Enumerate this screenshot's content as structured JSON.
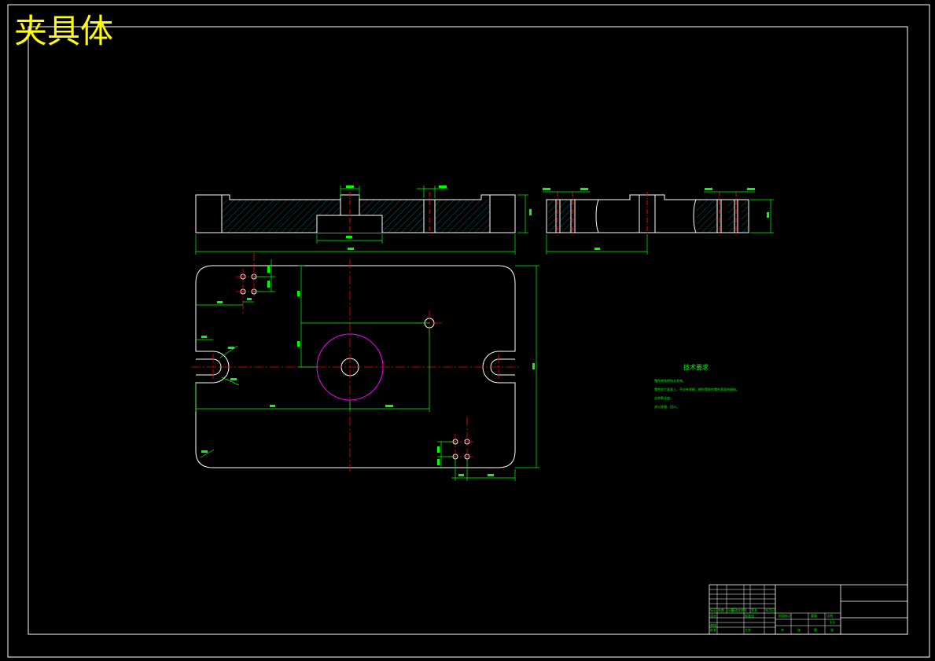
{
  "drawing_title": "夹具体",
  "technical_requirements": {
    "heading": "技术要求",
    "items": [
      "零件棱角倒钝去毛刺。",
      "零件加工表面上，不应有划痕、擦伤等损伤零件表面的缺陷。",
      "去除氧化皮。",
      "淬火处理，回火。"
    ]
  },
  "title_block": {
    "labels": [
      "标记",
      "处数",
      "分区",
      "更改文件号",
      "签名",
      "年月日",
      "设计",
      "标准化",
      "审核",
      "工艺",
      "批准",
      "阶段标记",
      "重量",
      "比例",
      "共",
      "张",
      "第",
      "张"
    ],
    "scale": "1:1"
  },
  "colors": {
    "outline": "#ffffff",
    "dimension": "#00ff00",
    "centerline": "#ff0000",
    "hatch": "#00ffff",
    "circle": "#ff00ff",
    "title": "#ffff00"
  }
}
